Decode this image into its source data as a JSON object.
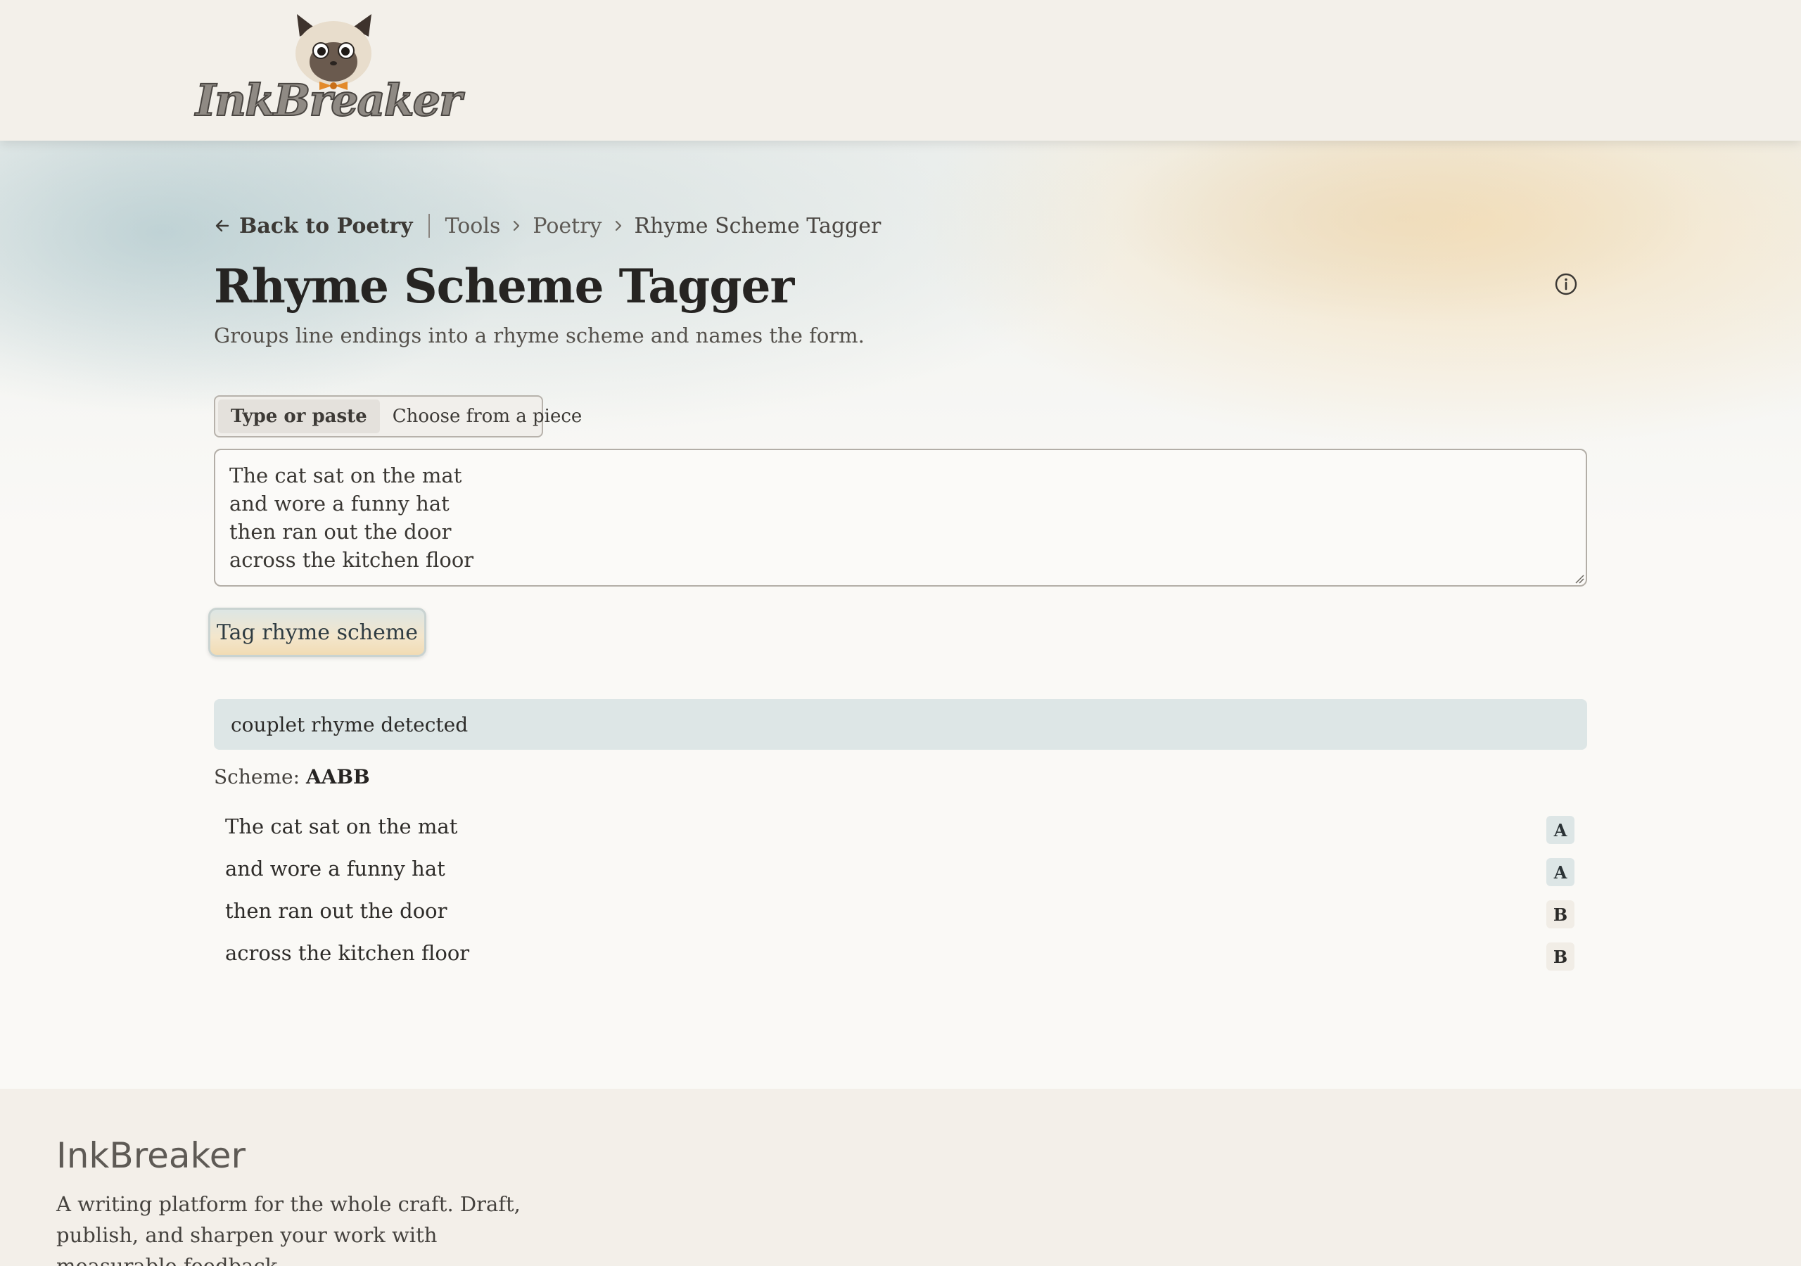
{
  "header": {
    "logo_text": "InkBreaker"
  },
  "breadcrumb": {
    "back_label": "Back to Poetry",
    "items": [
      "Tools",
      "Poetry",
      "Rhyme Scheme Tagger"
    ]
  },
  "page": {
    "title": "Rhyme Scheme Tagger",
    "subtitle": "Groups line endings into a rhyme scheme and names the form."
  },
  "mode_tabs": [
    {
      "label": "Type or paste",
      "active": true
    },
    {
      "label": "Choose from a piece",
      "active": false
    }
  ],
  "input": {
    "value": "The cat sat on the mat\nand wore a funny hat\nthen ran out the door\nacross the kitchen floor"
  },
  "action": {
    "tag_label": "Tag rhyme scheme"
  },
  "result": {
    "banner": "couplet rhyme detected",
    "scheme_label": "Scheme:",
    "scheme_value": "AABB",
    "lines": [
      {
        "text": "The cat sat on the mat",
        "tag": "A"
      },
      {
        "text": "and wore a funny hat",
        "tag": "A"
      },
      {
        "text": "then ran out the door",
        "tag": "B"
      },
      {
        "text": "across the kitchen floor",
        "tag": "B"
      }
    ]
  },
  "footer": {
    "brand": "InkBreaker",
    "tagline": "A writing platform for the whole craft. Draft, publish, and sharpen your work with measurable feedback."
  },
  "icons": {
    "back": "arrow-left-icon",
    "chevron": "chevron-right-icon",
    "info": "info-icon"
  },
  "colors": {
    "tag_a_bg": "#dde6e6",
    "tag_b_bg": "#f1ede6",
    "banner_bg": "#dde6e6"
  }
}
